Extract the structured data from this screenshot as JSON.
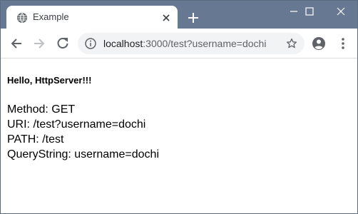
{
  "tab": {
    "title": "Example",
    "favicon": "globe-icon"
  },
  "window_controls": {
    "minimize_icon": "minimize-icon",
    "maximize_icon": "maximize-icon",
    "close_icon": "close-icon"
  },
  "toolbar": {
    "back_icon": "back-arrow-icon",
    "forward_icon": "forward-arrow-icon",
    "reload_icon": "reload-icon",
    "site_info_icon": "info-icon",
    "url_host": "localhost",
    "url_rest": ":3000/test?username=dochi",
    "bookmark_icon": "star-icon",
    "profile_icon": "account-circle-icon",
    "menu_icon": "more-vert-icon"
  },
  "colors": {
    "titlebar": "#667892",
    "tab_bg": "#ffffff",
    "omnibox_bg": "#f1f3f4",
    "icon": "#5f6368"
  },
  "page": {
    "greeting": "Hello, HttpServer!!!",
    "lines": [
      "Method: GET",
      "URI: /test?username=dochi",
      "PATH: /test",
      "QueryString: username=dochi"
    ]
  }
}
